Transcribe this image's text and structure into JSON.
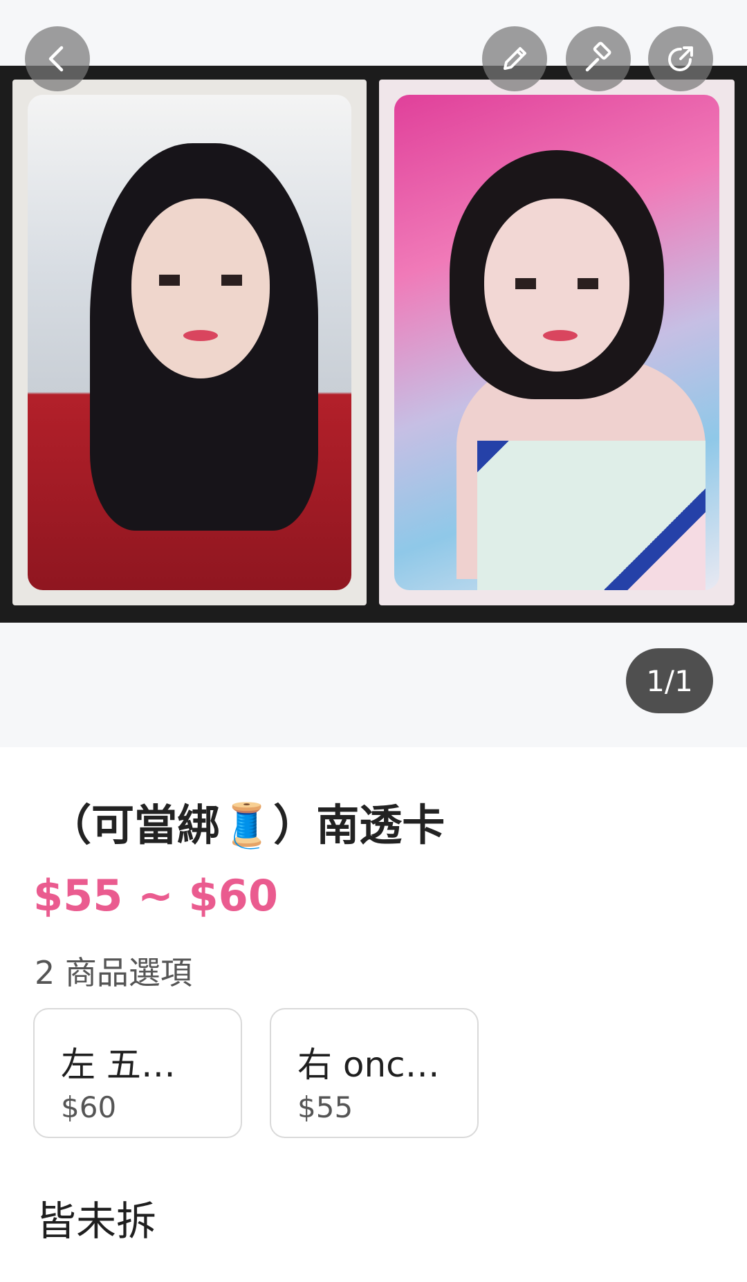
{
  "listing": {
    "title": "（可當綁🧵）南透卡",
    "price_range": "$55 ~ $60",
    "variant_count_text": "2 商品選項",
    "variants": [
      {
        "name": "左 五…",
        "price": "$60"
      },
      {
        "name": "右 onc…",
        "price": "$55"
      }
    ],
    "description": "皆未拆"
  },
  "gallery": {
    "counter": "1/1"
  },
  "toolbar": {
    "back_icon": "chevron-left-icon",
    "edit_icon": "pencil-icon",
    "bump_icon": "hammer-icon",
    "share_icon": "share-icon"
  },
  "colors": {
    "price": "#ea5b8f",
    "overlay_button": "#787878",
    "counter_bg": "#4f4f4f"
  }
}
